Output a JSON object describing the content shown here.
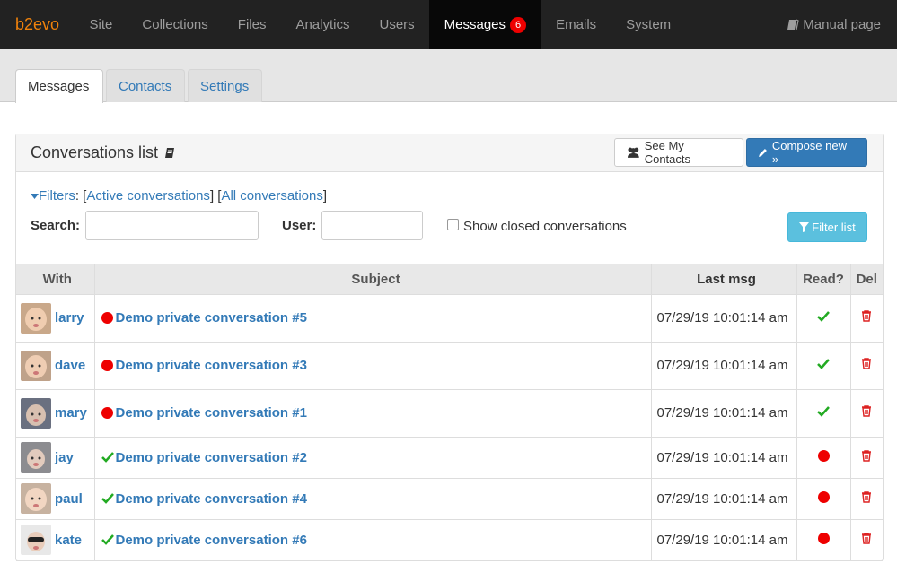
{
  "nav": {
    "brand": "b2evo",
    "items": [
      {
        "label": "Site"
      },
      {
        "label": "Collections"
      },
      {
        "label": "Files"
      },
      {
        "label": "Analytics"
      },
      {
        "label": "Users"
      },
      {
        "label": "Messages",
        "badge": "6"
      },
      {
        "label": "Emails"
      },
      {
        "label": "System"
      }
    ],
    "manual": "Manual page"
  },
  "tabs": [
    "Messages",
    "Contacts",
    "Settings"
  ],
  "panel": {
    "title": "Conversations list",
    "see_contacts": "See My Contacts",
    "compose": "Compose new »"
  },
  "filters": {
    "label": "Filters",
    "active": "Active conversations",
    "all": "All conversations",
    "search_label": "Search:",
    "search_value": "",
    "user_label": "User:",
    "user_value": "",
    "show_closed": "Show closed conversations",
    "filter_button": "Filter list"
  },
  "table": {
    "headers": [
      "With",
      "Subject",
      "Last msg",
      "Read?",
      "Del"
    ],
    "rows": [
      {
        "with": "larry",
        "subject": "Demo private conversation #5",
        "last": "07/29/19 10:01:14 am"
      },
      {
        "with": "dave",
        "subject": "Demo private conversation #3",
        "last": "07/29/19 10:01:14 am"
      },
      {
        "with": "mary",
        "subject": "Demo private conversation #1",
        "last": "07/29/19 10:01:14 am"
      },
      {
        "with": "jay",
        "subject": "Demo private conversation #2",
        "last": "07/29/19 10:01:14 am"
      },
      {
        "with": "paul",
        "subject": "Demo private conversation #4",
        "last": "07/29/19 10:01:14 am"
      },
      {
        "with": "kate",
        "subject": "Demo private conversation #6",
        "last": "07/29/19 10:01:14 am"
      }
    ]
  },
  "colors": {
    "accent": "#337ab7",
    "brand": "#f0820b",
    "unread": "#e00000",
    "read": "#22aa22"
  }
}
